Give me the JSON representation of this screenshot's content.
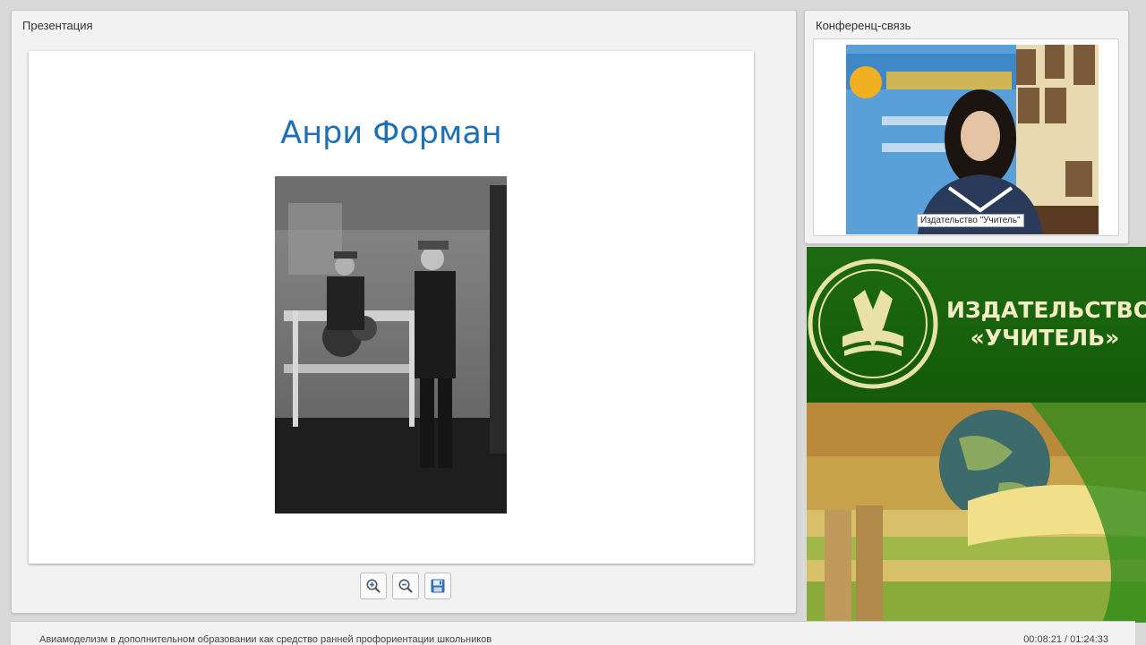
{
  "presentation": {
    "title": "Презентация",
    "slide": {
      "heading": "Анри Форман"
    },
    "toolbar": {
      "zoom_in_icon": "magnifier-plus-icon",
      "zoom_out_icon": "magnifier-minus-icon",
      "save_icon": "floppy-disk-icon"
    }
  },
  "conference": {
    "title": "Конференц-связь",
    "speaker_caption": "Издательство \"Учитель\""
  },
  "banner": {
    "line1": "ИЗДАТЕЛЬСТВО",
    "line2": "«УЧИТЕЛЬ»"
  },
  "footer": {
    "lecture_title": "Авиамоделизм в дополнительном образовании как средство ранней профориентации школьников",
    "time": "00:08:21 / 01:24:33"
  },
  "colors": {
    "heading": "#1f6fb5",
    "banner_green": "#1d6a12",
    "banner_text": "#f2edc4"
  }
}
